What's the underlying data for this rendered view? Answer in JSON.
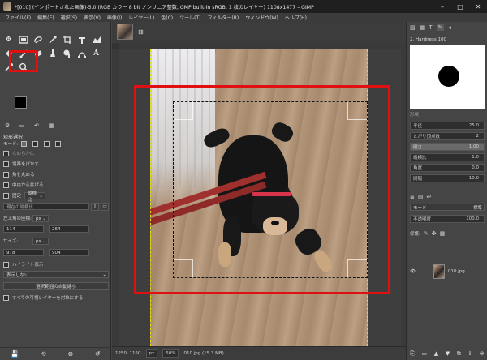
{
  "title": "*[010] (インポートされた画像)-5.0 (RGB カラー 8 bit ノンリニア整数, GMP built-in sRGB, 1 枚のレイヤー) 1108x1477 – GIMP",
  "window_controls": [
    "–",
    "□",
    "✕"
  ],
  "menu": [
    "ファイル(F)",
    "編集(E)",
    "選択(S)",
    "表示(V)",
    "画像(I)",
    "レイヤー(L)",
    "色(C)",
    "ツール(T)",
    "フィルター(R)",
    "ウィンドウ(W)",
    "ヘルプ(H)"
  ],
  "tool_options": {
    "title": "矩形選択",
    "mode_label": "モード:",
    "antialias": "なめらかに",
    "feather": "境界をぼかす",
    "rounded": "角を丸める",
    "expand_center": "中央から拡げる",
    "fixed_label": "固定",
    "fixed_value": "縦横比",
    "current_label": "現在の縦横比",
    "position_label": "左上角の座標:",
    "position_unit": "px",
    "pos_x": "114",
    "pos_y": "264",
    "size_label": "サイズ:",
    "size_unit": "px",
    "size_w": "978",
    "size_h": "904",
    "highlight": "ハイライト表示",
    "guides": "表示しない",
    "auto_shrink": "選択範囲の自動縮小",
    "all_layers": "すべての可視レイヤーを対象にする"
  },
  "status": {
    "coords": "1250, 1160",
    "unit": "px",
    "zoom": "50%",
    "file": "010.jpg (15.3 MB)"
  },
  "brushes": {
    "name": "2. Hardness 100",
    "basic_label": "形状"
  },
  "paint_params": [
    {
      "label": "半径",
      "value": "25.0"
    },
    {
      "label": "とがり頂点数",
      "value": "2"
    },
    {
      "label": "硬さ",
      "value": "1.00"
    },
    {
      "label": "縦横比",
      "value": "1.0"
    },
    {
      "label": "角度",
      "value": "0.0"
    },
    {
      "label": "間隔",
      "value": "10.0"
    }
  ],
  "layers": {
    "mode_label": "モード",
    "mode_value": "標準",
    "opacity_label": "不透明度",
    "opacity_value": "100.0",
    "lock_label": "保護:",
    "layer_name": "010.jpg"
  },
  "colors": {
    "highlight_red": "#e01010",
    "foreground": "#000000",
    "background": "#ffffff"
  }
}
